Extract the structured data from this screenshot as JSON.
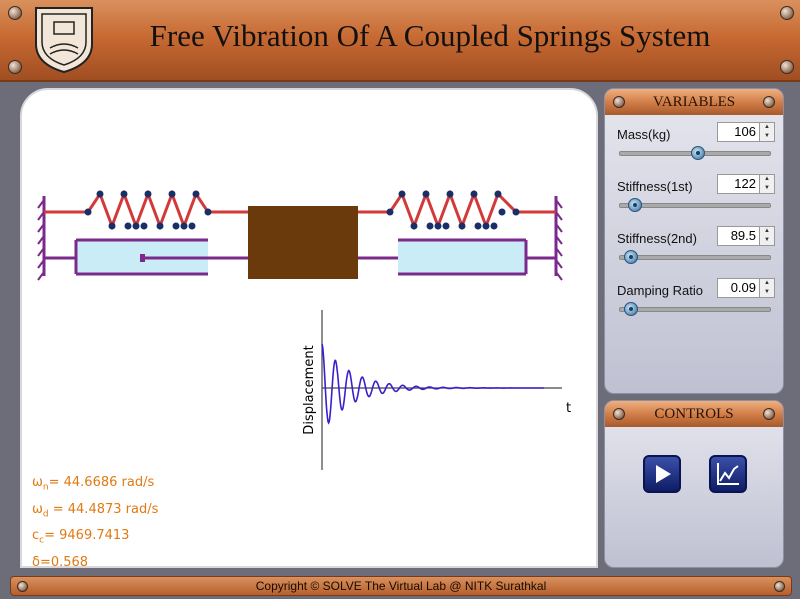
{
  "header": {
    "title": "Free Vibration Of A Coupled Springs System"
  },
  "plot": {
    "ylabel": "Displacement",
    "xlabel": "t"
  },
  "readouts": {
    "omega_n_symbol": "ω",
    "omega_n_sub": "n",
    "omega_n_value": "= 44.6686 rad/s",
    "omega_d_symbol": "ω",
    "omega_d_sub": "d",
    "omega_d_value": " = 44.4873 rad/s",
    "cc_symbol": "c",
    "cc_sub": "c",
    "cc_value": "= 9469.7413",
    "delta": "δ=0.568"
  },
  "variables": {
    "heading": "VARIABLES",
    "items": [
      {
        "label": "Mass(kg)",
        "value": "106",
        "level": 0.52
      },
      {
        "label": "Stiffness(1st)",
        "value": "122",
        "level": 0.1
      },
      {
        "label": "Stiffness(2nd)",
        "value": "89.5",
        "level": 0.07
      },
      {
        "label": "Damping Ratio",
        "value": "0.09",
        "level": 0.07
      }
    ]
  },
  "controls": {
    "heading": "CONTROLS",
    "play_icon": "play-icon",
    "graph_icon": "graph-icon"
  },
  "footer": {
    "text": "Copyright © SOLVE The Virtual Lab @ NITK Surathkal"
  },
  "colors": {
    "spring": "#d23a3a",
    "spring_node": "#1a2f66",
    "mass": "#6b3a0c",
    "dashpot_fill": "#c9ecf7",
    "dashpot_frame": "#7b2a8c",
    "wall": "#7b2a8c",
    "plot_line": "#3a1fcf",
    "readout": "#e07a12"
  }
}
